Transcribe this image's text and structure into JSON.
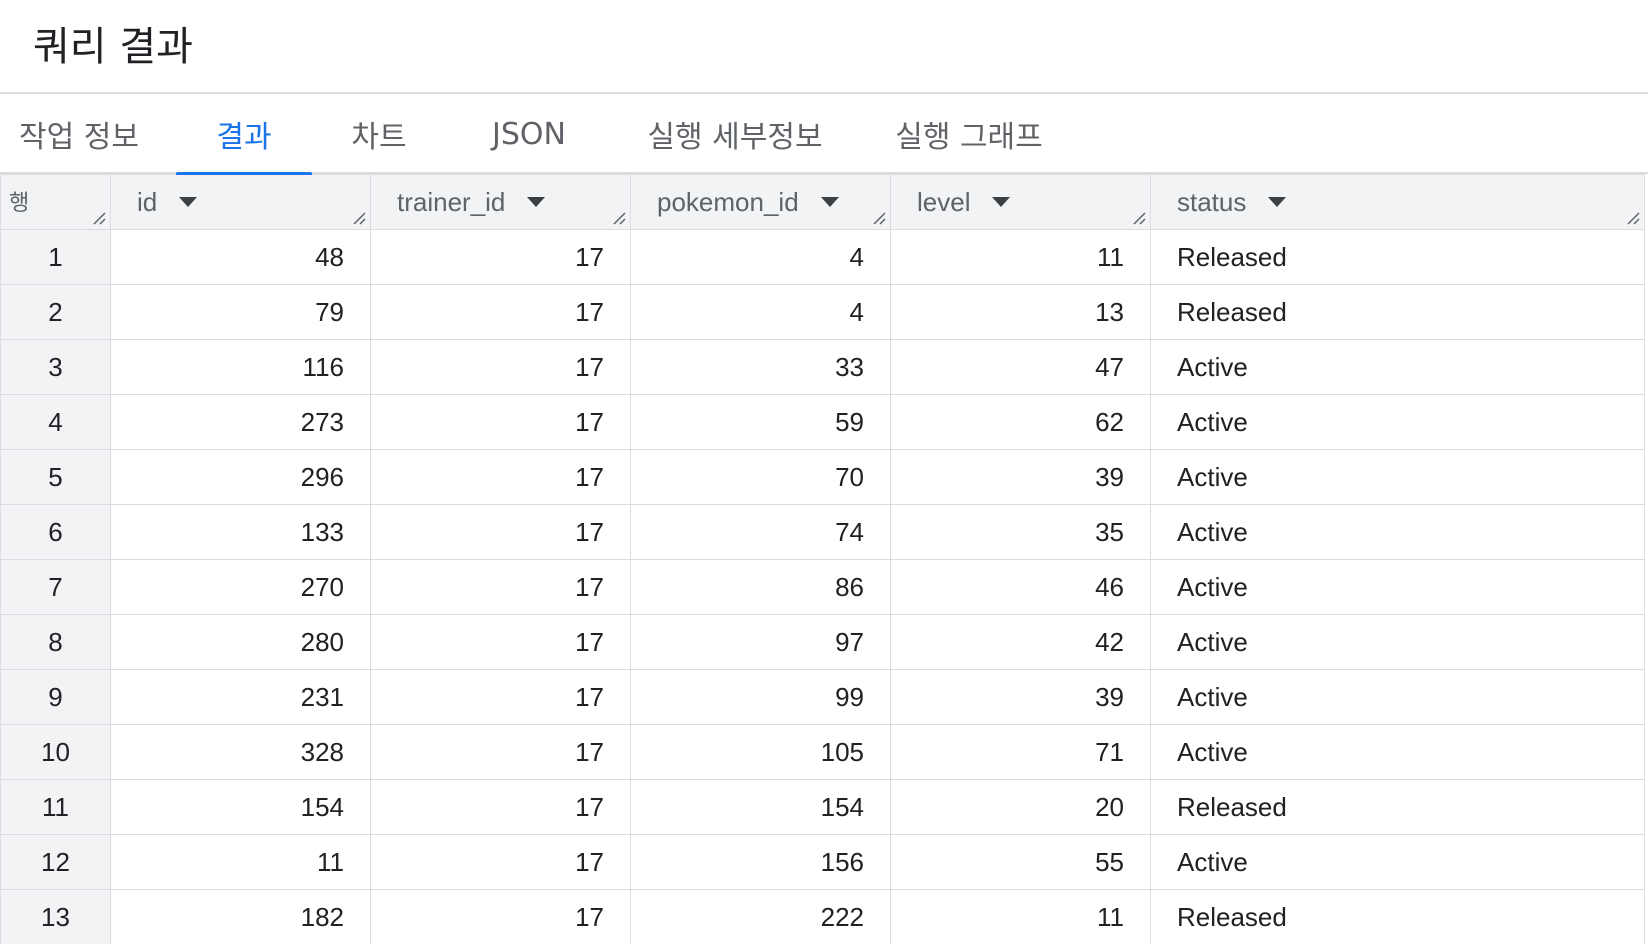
{
  "page_title": "쿼리 결과",
  "tabs": [
    {
      "label": "작업 정보"
    },
    {
      "label": "결과"
    },
    {
      "label": "차트"
    },
    {
      "label": "JSON"
    },
    {
      "label": "실행 세부정보"
    },
    {
      "label": "실행 그래프"
    }
  ],
  "active_tab": "결과",
  "table": {
    "row_header": "행",
    "columns": [
      "id",
      "trainer_id",
      "pokemon_id",
      "level",
      "status"
    ],
    "rows": [
      {
        "row": "1",
        "id": "48",
        "trainer_id": "17",
        "pokemon_id": "4",
        "level": "11",
        "status": "Released"
      },
      {
        "row": "2",
        "id": "79",
        "trainer_id": "17",
        "pokemon_id": "4",
        "level": "13",
        "status": "Released"
      },
      {
        "row": "3",
        "id": "116",
        "trainer_id": "17",
        "pokemon_id": "33",
        "level": "47",
        "status": "Active"
      },
      {
        "row": "4",
        "id": "273",
        "trainer_id": "17",
        "pokemon_id": "59",
        "level": "62",
        "status": "Active"
      },
      {
        "row": "5",
        "id": "296",
        "trainer_id": "17",
        "pokemon_id": "70",
        "level": "39",
        "status": "Active"
      },
      {
        "row": "6",
        "id": "133",
        "trainer_id": "17",
        "pokemon_id": "74",
        "level": "35",
        "status": "Active"
      },
      {
        "row": "7",
        "id": "270",
        "trainer_id": "17",
        "pokemon_id": "86",
        "level": "46",
        "status": "Active"
      },
      {
        "row": "8",
        "id": "280",
        "trainer_id": "17",
        "pokemon_id": "97",
        "level": "42",
        "status": "Active"
      },
      {
        "row": "9",
        "id": "231",
        "trainer_id": "17",
        "pokemon_id": "99",
        "level": "39",
        "status": "Active"
      },
      {
        "row": "10",
        "id": "328",
        "trainer_id": "17",
        "pokemon_id": "105",
        "level": "71",
        "status": "Active"
      },
      {
        "row": "11",
        "id": "154",
        "trainer_id": "17",
        "pokemon_id": "154",
        "level": "20",
        "status": "Released"
      },
      {
        "row": "12",
        "id": "11",
        "trainer_id": "17",
        "pokemon_id": "156",
        "level": "55",
        "status": "Active"
      },
      {
        "row": "13",
        "id": "182",
        "trainer_id": "17",
        "pokemon_id": "222",
        "level": "11",
        "status": "Released"
      }
    ]
  },
  "colors": {
    "accent": "#1a73e8",
    "header_bg": "#f1f3f4",
    "border": "#dadce0"
  }
}
